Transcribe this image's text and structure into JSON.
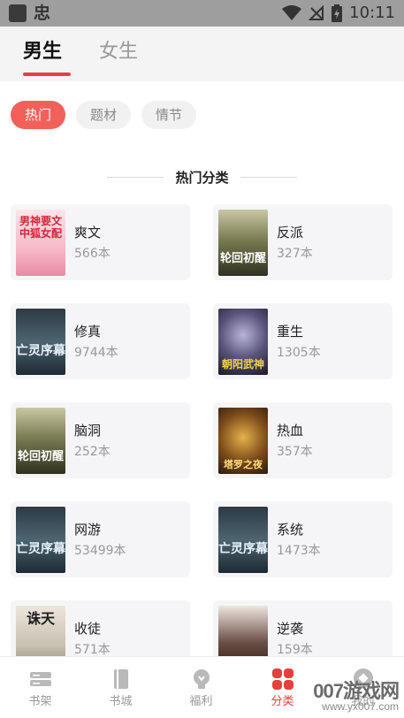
{
  "status_bar": {
    "time": "10:11"
  },
  "header": {
    "tabs": [
      {
        "label": "男生",
        "active": true
      },
      {
        "label": "女生",
        "active": false
      }
    ]
  },
  "filters": [
    {
      "label": "热门",
      "active": true
    },
    {
      "label": "题材",
      "active": false
    },
    {
      "label": "情节",
      "active": false
    }
  ],
  "section": {
    "title": "热门分类"
  },
  "categories": [
    {
      "name": "爽文",
      "count": "566本",
      "cover_text": "男神要文中狐女配"
    },
    {
      "name": "反派",
      "count": "327本",
      "cover_text": "轮回初醒"
    },
    {
      "name": "修真",
      "count": "9744本",
      "cover_text": "亡灵序幕"
    },
    {
      "name": "重生",
      "count": "1305本",
      "cover_text": "朝阳武神"
    },
    {
      "name": "脑洞",
      "count": "252本",
      "cover_text": "轮回初醒"
    },
    {
      "name": "热血",
      "count": "357本",
      "cover_text": "塔罗之夜"
    },
    {
      "name": "网游",
      "count": "53499本",
      "cover_text": "亡灵序幕"
    },
    {
      "name": "系统",
      "count": "1473本",
      "cover_text": "亡灵序幕"
    },
    {
      "name": "收徒",
      "count": "571本",
      "cover_text": "诛天"
    },
    {
      "name": "逆袭",
      "count": "159本",
      "cover_text": ""
    }
  ],
  "bottom_nav": [
    {
      "label": "书架",
      "icon": "bookshelf-icon",
      "active": false
    },
    {
      "label": "书城",
      "icon": "book-icon",
      "active": false
    },
    {
      "label": "福利",
      "icon": "gift-icon",
      "active": false
    },
    {
      "label": "分类",
      "icon": "category-icon",
      "active": true
    },
    {
      "label": "我的",
      "icon": "profile-icon",
      "active": false
    }
  ],
  "watermark": {
    "line1": "007游戏网",
    "line2": "www.yx007.com"
  },
  "colors": {
    "accent": "#e6403a",
    "chip_active": "#f2605a",
    "card_bg": "#f5f5f7"
  }
}
